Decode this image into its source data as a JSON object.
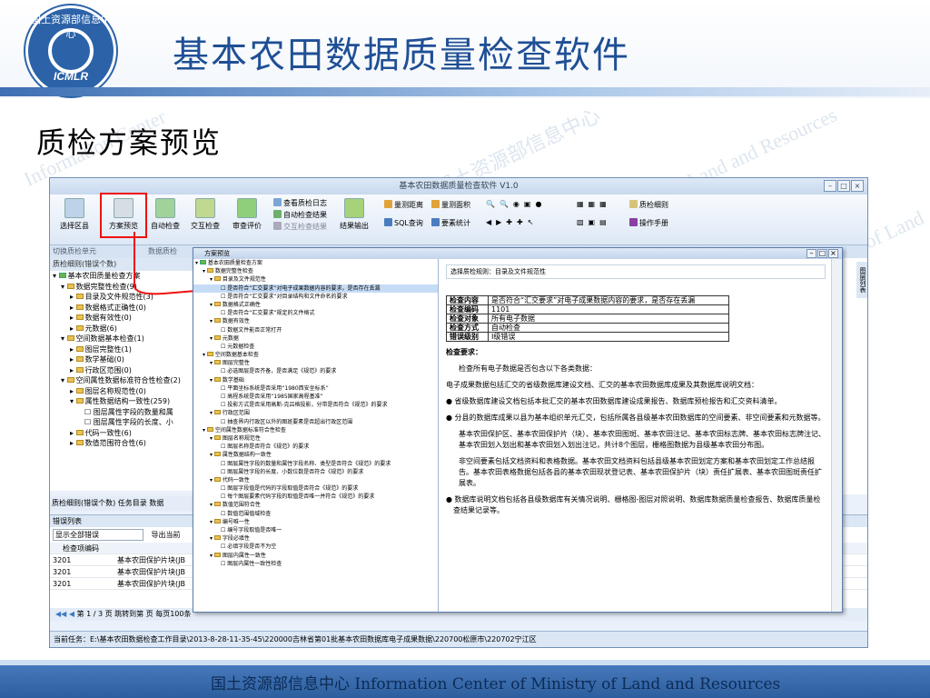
{
  "header": {
    "logo_top": "国土资源部信息中心",
    "logo_bottom": "ICMLR",
    "title": "基本农田数据质量检查软件"
  },
  "subtitle": "质检方案预览",
  "footer": "国土资源部信息中心  Information Center of Ministry of Land and Resources",
  "watermark": [
    "Information Center",
    "国土资源部信息中心",
    "Land and Resources",
    "of Land"
  ],
  "window": {
    "title": "基本农田数据质量检查软件 V1.0",
    "ribbon": {
      "buttons": [
        "选择区县",
        "方案预览",
        "自动检查",
        "交互检查",
        "审查评价",
        "结果输出"
      ],
      "small": [
        "查看质检日志",
        "自动检查结果",
        "交互检查结果",
        "量测距离",
        "量测面积",
        "SQL查询",
        "要素统计",
        "质检细则",
        "操作手册"
      ]
    },
    "group_row": "切换质检单元",
    "group_row2": "数据质检",
    "left_header": "质检细则(错误个数)",
    "tree": [
      "基本农田质量检查方案",
      "数据完整性检查(9)",
      "目录及文件规范性(3)",
      "数据格式正确性(0)",
      "数据有效性(0)",
      "元数据(6)",
      "空间数据基本检查(1)",
      "图层完整性(1)",
      "数学基础(0)",
      "行政区范围(0)",
      "空间属性数据标准符合性检查(2)",
      "图层名称规范性(0)",
      "属性数据结构一致性(259)",
      "图层属性字段的数量和属",
      "图层属性字段的长度、小",
      "代码一致性(6)",
      "数值范围符合性(6)"
    ],
    "left_tabs": "质检细则(错误个数)  任务目录  数据",
    "err_header": "错误列表",
    "err_filter": "显示全部错误",
    "err_export": "导出当前",
    "err_col": "检查项编码",
    "err_rows": [
      [
        "3201",
        "基本农田保护片块(JB"
      ],
      [
        "3201",
        "基本农田保护片块(JB"
      ],
      [
        "3201",
        "基本农田保护片块(JB"
      ]
    ],
    "pager": "第 1 / 3 页   跳转到第     页   每页100条",
    "status": "当前任务：E:\\基本农田数据检查工作目录\\2013-8-28-11-35-45\\220000吉林省第01批基本农田数据库电子成果数据\\220700松原市\\220702宁江区",
    "right_tab": "图层列表"
  },
  "dialog": {
    "title": "方案预览",
    "tree": [
      "基本农田质量检查方案",
      "数据完整性检查",
      "目录及文件规范性",
      "是否符合“汇交要求”对电子成果数据内容的要求，是否存在丢漏",
      "是否符合“汇交要求”对目录结构和文件命名的要求",
      "数据格式正确性",
      "是否符合“汇交要求”规定的文件格式",
      "数据有效性",
      "数据文件能否正常打开",
      "元数据",
      "元数据检查",
      "空间数据基本检查",
      "图层完整性",
      "必选图层是否齐备，是否满足《规范》的要求",
      "数学基础",
      "平面坐标系统是否采用“1980西安坐标系”",
      "高程系统是否采用“1985国家高程基准”",
      "投影方式是否采用高斯-克吕格投影，分带是否符合《规范》的要求",
      "行政区范围",
      "抽查界内行政区以外的图斑要素是否超出行政区范围",
      "空间属性数据标准符合性检查",
      "图层名称规范性",
      "图层名称是否符合《规范》的要求",
      "属性数据结构一致性",
      "图层属性字段的数量和属性字段名称、类型是否符合《规范》的要求",
      "图层属性字段的长度、小数位数是否符合《规范》的要求",
      "代码一致性",
      "图层字段值是代码的字段取值是否符合《规范》的要求",
      "每个图层要素代码字段的取值是否唯一并符合《规范》的要求",
      "数值范围符合性",
      "数值范围值域检查",
      "编号唯一性",
      "编号字段取值是否唯一",
      "字段必填性",
      "必填字段是否不为空",
      "图层内属性一致性",
      "图层内属性一致性检查"
    ],
    "rule_label": "选择质检规则：目录及文件规范性",
    "table": [
      [
        "检查内容",
        "是否符合“汇交要求”对电子成果数据内容的要求，是否存在丢漏"
      ],
      [
        "检查编码",
        "1101"
      ],
      [
        "检查对象",
        "所有电子数据"
      ],
      [
        "检查方式",
        "自动检查"
      ],
      [
        "错误级别",
        "Ⅰ级错误"
      ]
    ],
    "req_title": "检查要求：",
    "p1": "检查所有电子数据是否包含以下各类数据：",
    "p2": "电子成果数据包括汇交的省级数据库建设文档、汇交的基本农田数据库成果及其数据库说明文档：",
    "b1": "省级数据库建设文档包括本批汇交的基本农田数据库建设成果报告、数据库预检报告和汇交资料清单。",
    "b2": "分县的数据库成果以县为基本组织单元汇交，包括所属各县级基本农田数据库的空间要素、非空间要素和元数据等。",
    "p3": "基本农田保护区、基本农田保护片（块）、基本农田图斑、基本农田注记、基本农田标志牌、基本农田标志牌注记、基本农田划入划出和基本农田划入划出注记，共计8个图层，栅格图数据为县级基本农田分布图。",
    "p4": "非空间要素包括文档资料和表格数据。基本农田文档资料包括县级基本农田划定方案和基本农田划定工作总结报告。基本农田表格数据包括各县的基本农田现状登记表、基本农田保护片（块）责任扩展表、基本农田图斑责任扩展表。",
    "b3": "数据库说明文档包括各县级数据库有关情况说明、栅格图-图层对照说明、数据库数据质量检查报告、数据库质量检查结果记录等。"
  }
}
